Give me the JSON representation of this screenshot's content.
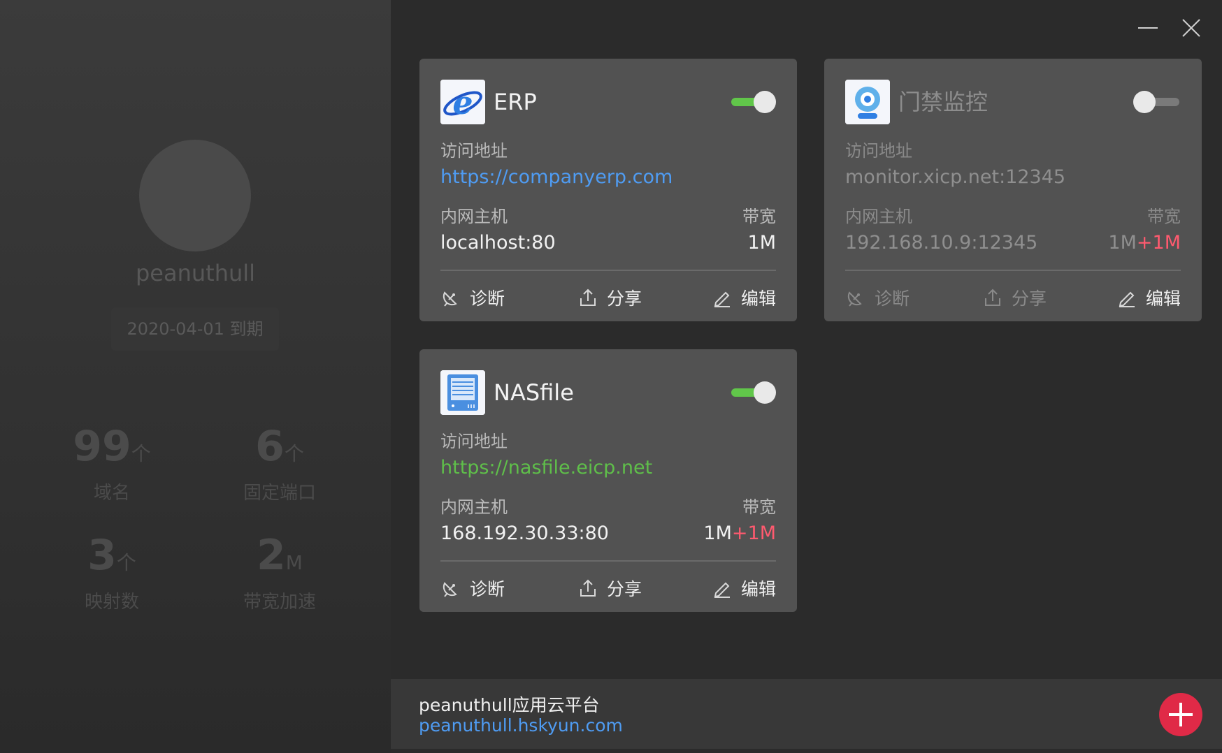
{
  "sidebar": {
    "username": "peanuthull",
    "expire": "2020-04-01 到期",
    "stats": [
      {
        "num": "99",
        "unit": "个",
        "label": "域名"
      },
      {
        "num": "6",
        "unit": "个",
        "label": "固定端口"
      },
      {
        "num": "3",
        "unit": "个",
        "label": "映射数"
      },
      {
        "num": "2",
        "unit": "M",
        "label": "带宽加速"
      }
    ]
  },
  "labels": {
    "access": "访问地址",
    "host": "内网主机",
    "bandwidth": "带宽",
    "diagnose": "诊断",
    "share": "分享",
    "edit": "编辑"
  },
  "cards": [
    {
      "title": "ERP",
      "enabled": true,
      "icon": "ie-icon",
      "url": "https://companyerp.com",
      "url_color": "#4f9cf3",
      "host": "localhost:80",
      "bw": "1M",
      "bw_plus": ""
    },
    {
      "title": "门禁监控",
      "enabled": false,
      "icon": "webcam-icon",
      "url": "monitor.xicp.net:12345",
      "url_color": "#8f8f8f",
      "host": "192.168.10.9:12345",
      "bw": "1M",
      "bw_plus": "+1M"
    },
    {
      "title": "NASfile",
      "enabled": true,
      "icon": "nas-icon",
      "url": "https://nasfile.eicp.net",
      "url_color": "#5fbf4a",
      "host": "168.192.30.33:80",
      "bw": "1M",
      "bw_plus": "+1M"
    }
  ],
  "footer": {
    "title": "peanuthull应用云平台",
    "link": "peanuthull.hskyun.com"
  },
  "colors": {
    "toggle_on": "#61c64a",
    "add_button": "#e02a47",
    "link": "#4f9cf3"
  }
}
